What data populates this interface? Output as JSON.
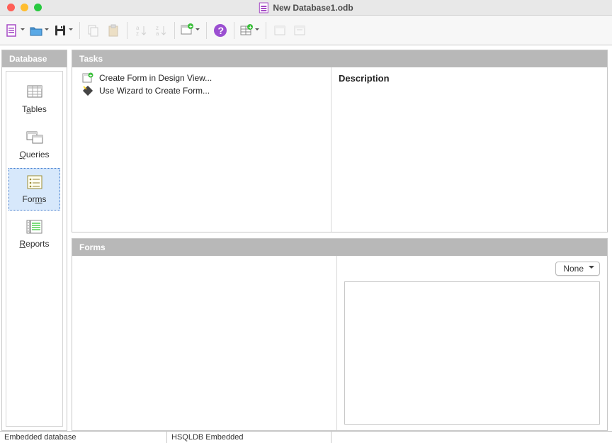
{
  "window": {
    "title": "New Database1.odb"
  },
  "sidebar": {
    "header": "Database",
    "items": [
      {
        "label_pre": "T",
        "label_u": "a",
        "label_post": "bles"
      },
      {
        "label_pre": "",
        "label_u": "Q",
        "label_post": "ueries"
      },
      {
        "label_pre": "For",
        "label_u": "m",
        "label_post": "s"
      },
      {
        "label_pre": "",
        "label_u": "R",
        "label_post": "eports"
      }
    ],
    "selected_index": 2
  },
  "tasks": {
    "header": "Tasks",
    "items": [
      {
        "label": "Create Form in Design View..."
      },
      {
        "label": "Use Wizard to Create Form..."
      }
    ],
    "description_title": "Description"
  },
  "forms": {
    "header": "Forms",
    "preview_mode": "None"
  },
  "status": {
    "db_type_label": "Embedded database",
    "db_engine": "HSQLDB Embedded"
  }
}
